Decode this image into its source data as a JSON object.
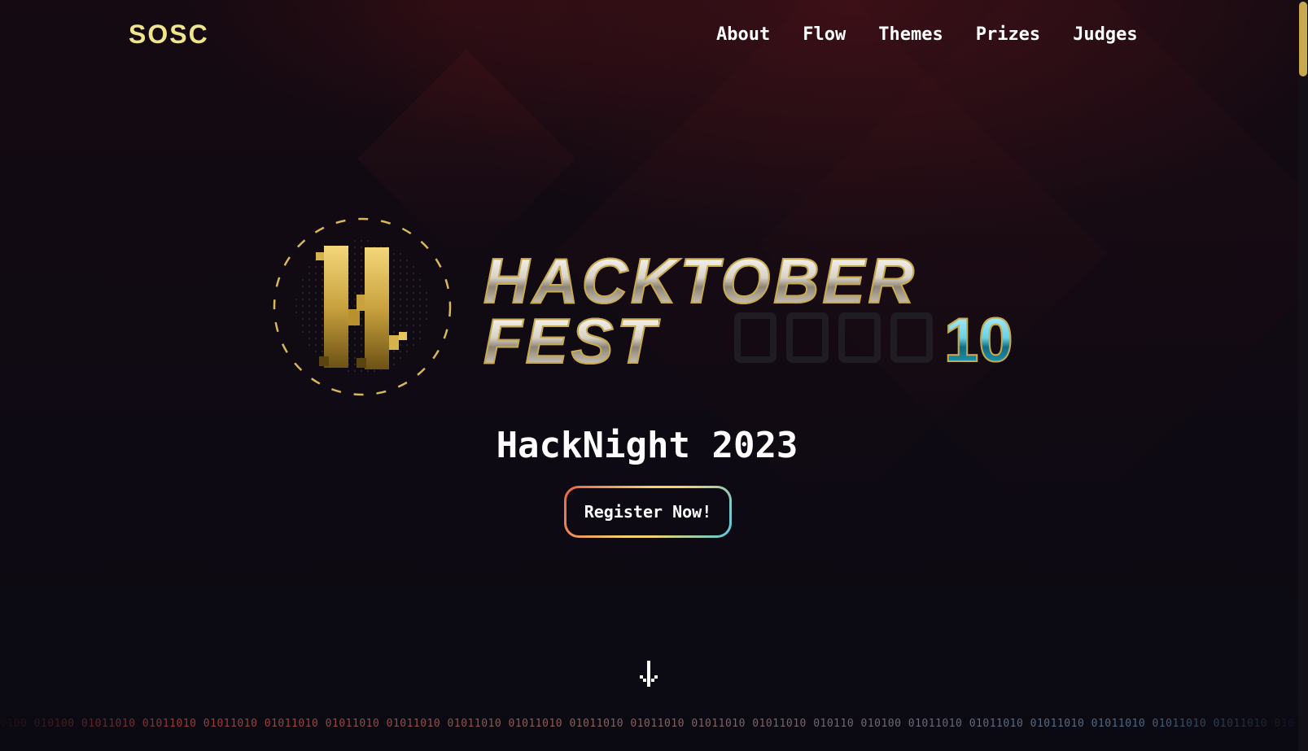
{
  "brand": {
    "logo_text": "SOSC"
  },
  "nav": {
    "items": [
      {
        "label": "About"
      },
      {
        "label": "Flow"
      },
      {
        "label": "Themes"
      },
      {
        "label": "Prizes"
      },
      {
        "label": "Judges"
      }
    ]
  },
  "hero": {
    "title_line1": "HACKTOBER",
    "title_line2": "FEST",
    "title_number": "10",
    "subtitle": "HackNight 2023",
    "cta_label": "Register Now!"
  },
  "footer_ticker": {
    "text": "0100 010100 01011010 01011010 01011010 01011010 01011010 01011010 01011010 01011010 01011010 01011010 01011010 01011010 010110 010100 01011010 01011010 01011010 01011010 01011010 01011010 01011010 010"
  },
  "colors": {
    "background": "#0d0a14",
    "accent_gold": "#c8a94c",
    "logo_yellow": "#f0e48c",
    "accent_cyan": "#57c6e0",
    "accent_red": "#e8614a"
  },
  "icons": {
    "hero_emblem": "hacktoberfest-pixel-h-icon",
    "scroll": "arrow-down-icon"
  }
}
